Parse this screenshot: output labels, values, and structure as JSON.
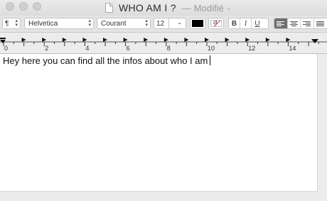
{
  "window": {
    "title": "WHO AM I ?",
    "separator": "—",
    "status": "Modifié",
    "status_chevron": "⌄"
  },
  "toolbar": {
    "paragraph_style": "¶",
    "font_family": "Helvetica",
    "font_style": "Courant",
    "font_size": "12",
    "text_color": "#000000",
    "bold_label": "B",
    "italic_label": "I",
    "underline_label": "U",
    "active_alignment": "left"
  },
  "ruler": {
    "labels": [
      "0",
      "2",
      "4",
      "6",
      "8",
      "10",
      "12",
      "14"
    ]
  },
  "document": {
    "text": "Hey here you can find all the infos about who I am"
  },
  "icons": {
    "document": "document-icon",
    "paragraph": "paragraph-style-icon",
    "align_left": "align-left-icon",
    "align_center": "align-center-icon",
    "align_right": "align-right-icon",
    "justify": "justify-icon"
  }
}
